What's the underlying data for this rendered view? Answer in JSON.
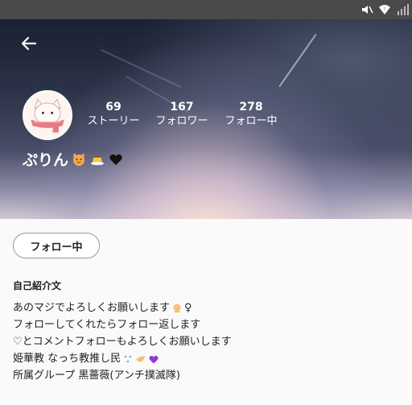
{
  "status_bar": {
    "icons": [
      "mute-icon",
      "wifi-icon",
      "signal-icon"
    ]
  },
  "header": {
    "back_icon": "arrow-left-icon",
    "avatar_icon": "cat-with-scarf-avatar",
    "stats": [
      {
        "value": "69",
        "label": "ストーリー"
      },
      {
        "value": "167",
        "label": "フォロワー"
      },
      {
        "value": "278",
        "label": "フォロー中"
      }
    ],
    "username": "ぷりん",
    "username_emojis": [
      "cat-face-emoji",
      "pudding-emoji",
      "black-heart-emoji"
    ]
  },
  "actions": {
    "follow_button_label": "フォロー中"
  },
  "bio": {
    "title": "自己紹介文",
    "lines": [
      "あのマジでよろしくお願いします",
      "♀",
      "フォローしてくれたらフォロー返します",
      "♡とコメントフォローもよろしくお願いします",
      "姫華教 なっち教推し民",
      "所属グループ 黒薔薇(アンチ撲滅隊)"
    ]
  },
  "colors": {
    "status_bar": "#4a4a4c",
    "background": "#fafafa",
    "text": "#222222"
  }
}
